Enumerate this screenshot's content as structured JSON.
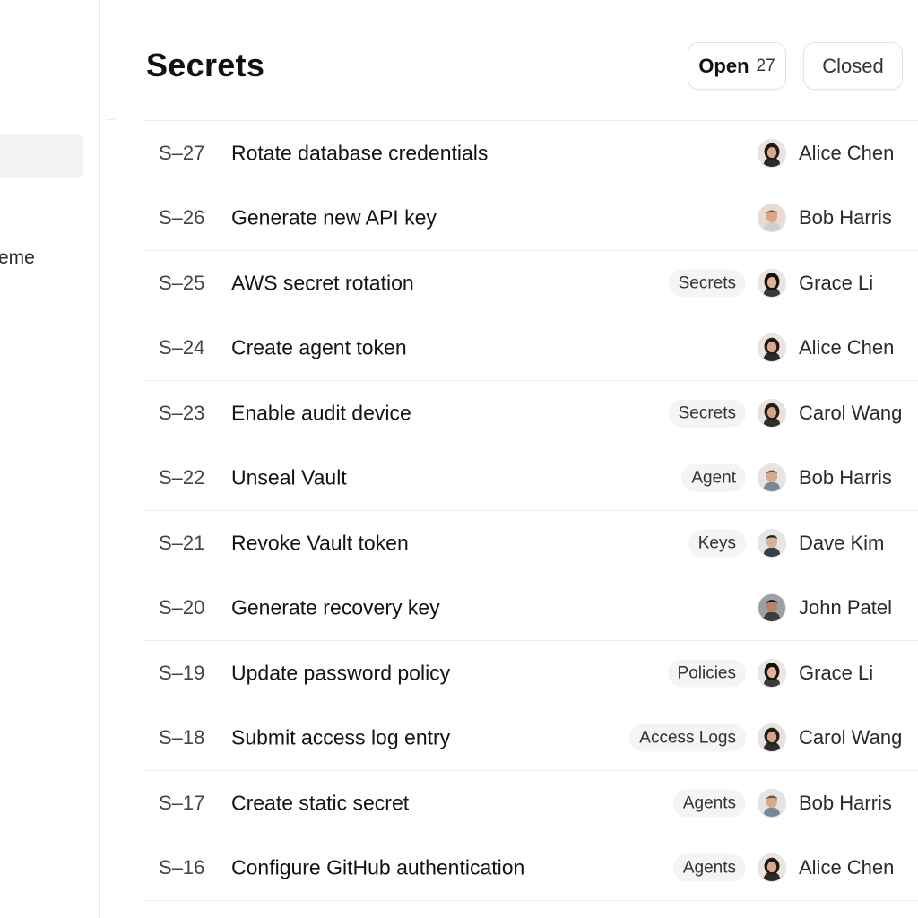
{
  "sidebar": {
    "visible_text": "eme"
  },
  "page": {
    "title": "Secrets"
  },
  "filters": {
    "open_label": "Open",
    "open_count": "27",
    "closed_label": "Closed"
  },
  "rows": [
    {
      "id": "S–27",
      "title": "Rotate database credentials",
      "tag": "",
      "assignee": "Alice Chen"
    },
    {
      "id": "S–26",
      "title": "Generate new API key",
      "tag": "",
      "assignee": "Bob Harris"
    },
    {
      "id": "S–25",
      "title": "AWS secret rotation",
      "tag": "Secrets",
      "assignee": "Grace Li"
    },
    {
      "id": "S–24",
      "title": "Create agent token",
      "tag": "",
      "assignee": "Alice Chen"
    },
    {
      "id": "S–23",
      "title": "Enable audit device",
      "tag": "Secrets",
      "assignee": "Carol Wang"
    },
    {
      "id": "S–22",
      "title": "Unseal Vault",
      "tag": "Agent",
      "assignee": "Bob Harris"
    },
    {
      "id": "S–21",
      "title": "Revoke Vault token",
      "tag": "Keys",
      "assignee": "Dave Kim"
    },
    {
      "id": "S–20",
      "title": "Generate recovery key",
      "tag": "",
      "assignee": "John Patel"
    },
    {
      "id": "S–19",
      "title": "Update password policy",
      "tag": "Policies",
      "assignee": "Grace Li"
    },
    {
      "id": "S–18",
      "title": "Submit access log entry",
      "tag": "Access Logs",
      "assignee": "Carol Wang"
    },
    {
      "id": "S–17",
      "title": "Create static secret",
      "tag": "Agents",
      "assignee": "Bob Harris"
    },
    {
      "id": "S–16",
      "title": "Configure GitHub authentication",
      "tag": "Agents",
      "assignee": "Alice Chen"
    }
  ]
}
